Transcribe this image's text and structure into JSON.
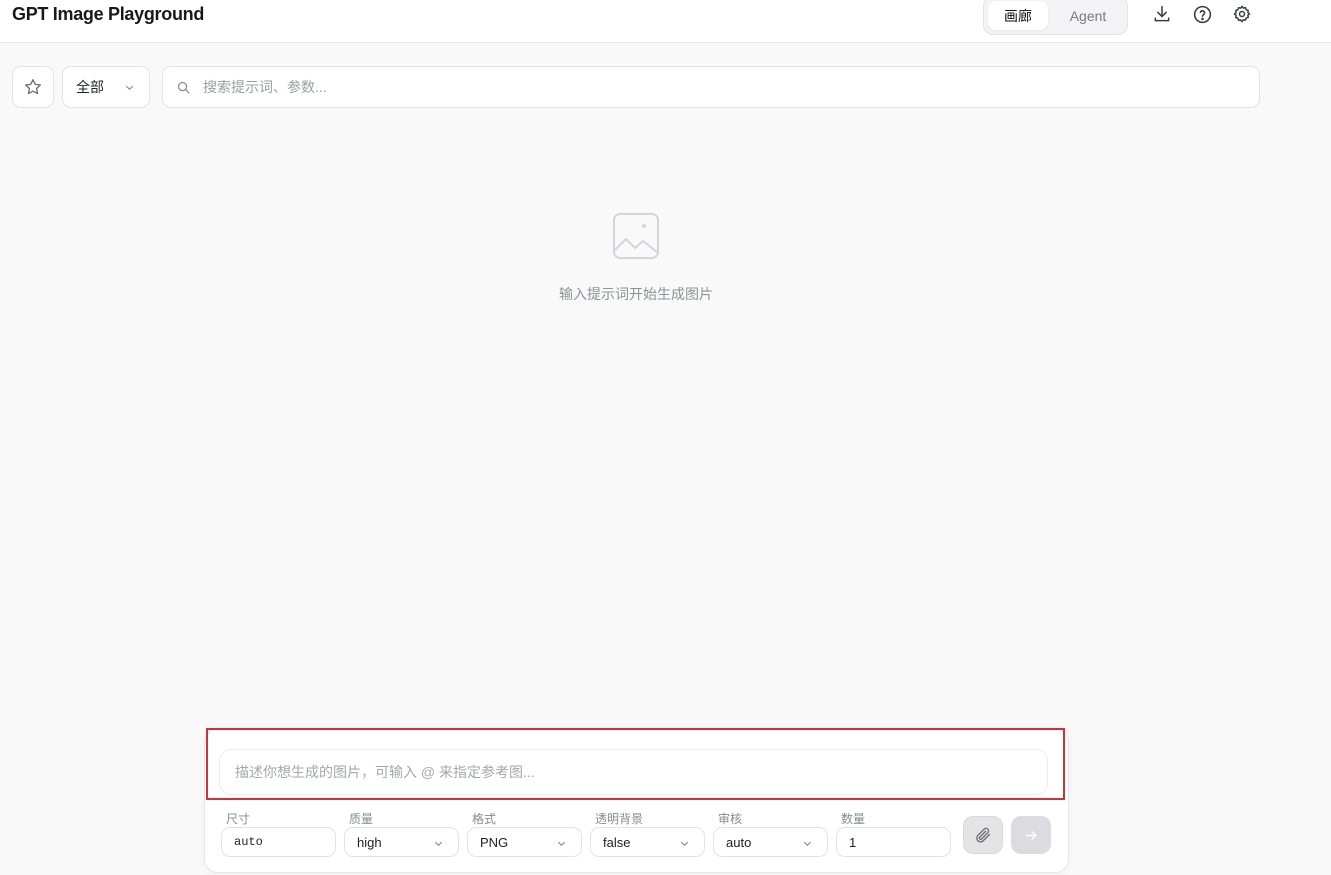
{
  "header": {
    "title": "GPT Image Playground",
    "modes": [
      {
        "label": "画廊",
        "active": true
      },
      {
        "label": "Agent",
        "active": false
      }
    ],
    "icons": [
      "download-icon",
      "help-icon",
      "settings-icon"
    ]
  },
  "toolbar": {
    "favorite_icon": "star-icon",
    "filter_value": "全部",
    "search_placeholder": "搜索提示词、参数..."
  },
  "empty_state": {
    "icon": "image-placeholder-icon",
    "text": "输入提示词开始生成图片"
  },
  "composer": {
    "prompt_placeholder": "描述你想生成的图片，可输入 @ 来指定参考图...",
    "params": [
      {
        "label": "尺寸",
        "value": "auto",
        "type": "text"
      },
      {
        "label": "质量",
        "value": "high",
        "type": "select"
      },
      {
        "label": "格式",
        "value": "PNG",
        "type": "select"
      },
      {
        "label": "透明背景",
        "value": "false",
        "type": "select"
      },
      {
        "label": "审核",
        "value": "auto",
        "type": "select"
      },
      {
        "label": "数量",
        "value": "1",
        "type": "number"
      }
    ],
    "attach_icon": "paperclip-icon",
    "send_icon": "arrow-right-icon"
  },
  "colors": {
    "background": "#f9f9fa",
    "highlight_border": "#d32f3a",
    "muted_text": "#8e9197"
  }
}
